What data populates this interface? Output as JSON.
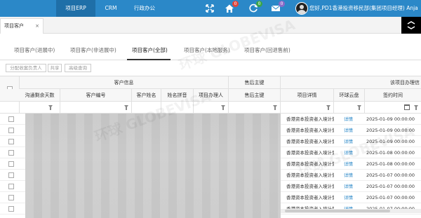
{
  "topbar": {
    "modules": [
      {
        "label": "项目ERP",
        "active": true
      },
      {
        "label": "CRM",
        "active": false
      },
      {
        "label": "行政办公",
        "active": false
      }
    ],
    "badges": {
      "home": "0",
      "refresh": "0",
      "mail": "0"
    },
    "user_greeting": "您好,PD1香港投资移民部(集团项目经理) Anja"
  },
  "page_tab": {
    "label": "项目客户",
    "close": "×"
  },
  "sub_tabs": [
    {
      "label": "项目客户(进展中)",
      "active": false
    },
    {
      "label": "项目客户(非进展中)",
      "active": false
    },
    {
      "label": "项目客户(全部)",
      "active": true
    },
    {
      "label": "项目客户(本地服务)",
      "active": false
    },
    {
      "label": "项目客户(回退售前)",
      "active": false
    }
  ],
  "toolbar": {
    "assign_label": "分配收案负责人",
    "share_label": "共享",
    "advanced_search_label": "高级查询"
  },
  "grid": {
    "group_headers": [
      "客户信息",
      "售后主键",
      "该项目办理信"
    ],
    "columns": [
      "沟通剩余天数",
      "客户编号",
      "客户姓名",
      "姓名拼音",
      "项目办理人",
      "售后主键",
      "项目详情",
      "环球云盘",
      "签约时间"
    ],
    "rows": [
      {
        "detail": "香港资本投资者入境计划",
        "cloud": "详情",
        "date": "2025-01-09 00:00:00"
      },
      {
        "detail": "香港资本投资者入境计划",
        "cloud": "详情",
        "date": "2025-01-09 00:00:00"
      },
      {
        "detail": "香港资本投资者入境计划",
        "cloud": "详情",
        "date": "2025-01-09 00:00:00"
      },
      {
        "detail": "香港资本投资者入境计划",
        "cloud": "详情",
        "date": "2025-01-08 00:00:00"
      },
      {
        "detail": "香港资本投资者入境计划",
        "cloud": "详情",
        "date": "2025-01-08 00:00:00"
      },
      {
        "detail": "香港资本投资者入境计划",
        "cloud": "详情",
        "date": "2025-01-07 00:00:00"
      },
      {
        "detail": "香港资本投资者入境计划",
        "cloud": "详情",
        "date": "2025-01-07 00:00:00"
      },
      {
        "detail": "香港资本投资者入境计划",
        "cloud": "详情",
        "date": "2025-01-07 00:00:00"
      },
      {
        "detail": "香港资本投资者入境计划",
        "cloud": "详情",
        "date": "2025-01-07 00:00:00"
      }
    ]
  },
  "watermark": "环球 GLOBEVISA",
  "colors": {
    "topbar": "#2b88c8",
    "link": "#2b88c8",
    "badge_red": "#e0463c",
    "badge_green": "#3aa54a",
    "badge_purple": "#8a6bc9"
  }
}
